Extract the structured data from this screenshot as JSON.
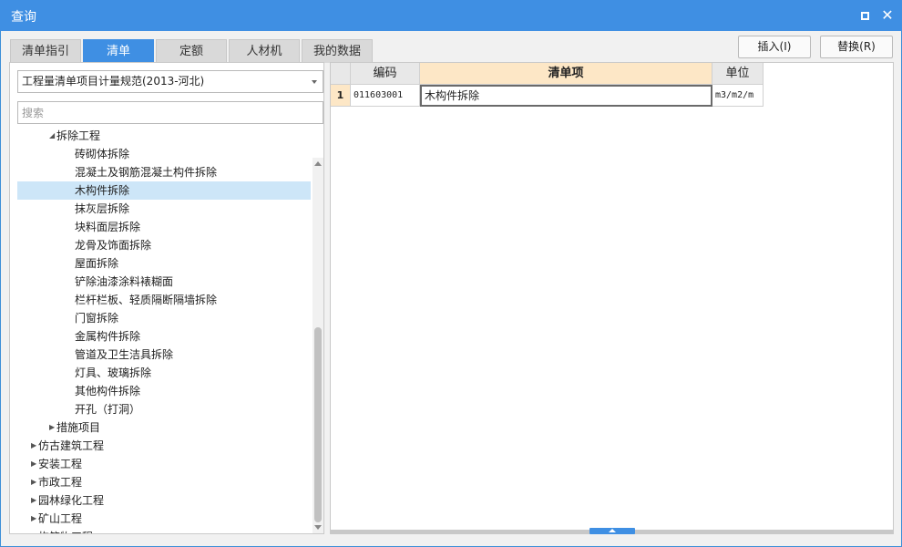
{
  "window": {
    "title": "查询",
    "maximize_icon": "maximize-icon",
    "close_icon": "close-icon",
    "close_glyph": "✕"
  },
  "tabs": [
    {
      "label": "清单指引",
      "active": false
    },
    {
      "label": "清单",
      "active": true
    },
    {
      "label": "定额",
      "active": false
    },
    {
      "label": "人材机",
      "active": false
    },
    {
      "label": "我的数据",
      "active": false
    }
  ],
  "toolbar": {
    "insert_label": "插入(I)",
    "replace_label": "替换(R)"
  },
  "left": {
    "spec_select": {
      "value": "工程量清单项目计量规范(2013-河北)"
    },
    "search": {
      "placeholder": "搜索",
      "value": ""
    },
    "tree": [
      {
        "label": "拆除工程",
        "depth": 1,
        "expanded": true
      },
      {
        "label": "砖砌体拆除",
        "depth": 2
      },
      {
        "label": "混凝土及钢筋混凝土构件拆除",
        "depth": 2
      },
      {
        "label": "木构件拆除",
        "depth": 2,
        "selected": true
      },
      {
        "label": "抹灰层拆除",
        "depth": 2
      },
      {
        "label": "块料面层拆除",
        "depth": 2
      },
      {
        "label": "龙骨及饰面拆除",
        "depth": 2
      },
      {
        "label": "屋面拆除",
        "depth": 2
      },
      {
        "label": "铲除油漆涂料裱糊面",
        "depth": 2
      },
      {
        "label": "栏杆栏板、轻质隔断隔墙拆除",
        "depth": 2
      },
      {
        "label": "门窗拆除",
        "depth": 2
      },
      {
        "label": "金属构件拆除",
        "depth": 2
      },
      {
        "label": "管道及卫生洁具拆除",
        "depth": 2
      },
      {
        "label": "灯具、玻璃拆除",
        "depth": 2
      },
      {
        "label": "其他构件拆除",
        "depth": 2
      },
      {
        "label": "开孔（打洞）",
        "depth": 2
      },
      {
        "label": "措施项目",
        "depth": 1,
        "expanded": false
      },
      {
        "label": "仿古建筑工程",
        "depth": 0,
        "expanded": false
      },
      {
        "label": "安装工程",
        "depth": 0,
        "expanded": false
      },
      {
        "label": "市政工程",
        "depth": 0,
        "expanded": false
      },
      {
        "label": "园林绿化工程",
        "depth": 0,
        "expanded": false
      },
      {
        "label": "矿山工程",
        "depth": 0,
        "expanded": false
      },
      {
        "label": "构筑物工程",
        "depth": 0,
        "expanded": false
      }
    ]
  },
  "grid": {
    "columns": [
      "编码",
      "清单项",
      "单位"
    ],
    "rows": [
      {
        "num": "1",
        "code": "011603001",
        "name": "木构件拆除",
        "unit": "m3/m2/m"
      }
    ]
  },
  "colors": {
    "accent": "#3f8fe3",
    "selection": "#cde6f8",
    "header_active": "#fde7c6"
  }
}
